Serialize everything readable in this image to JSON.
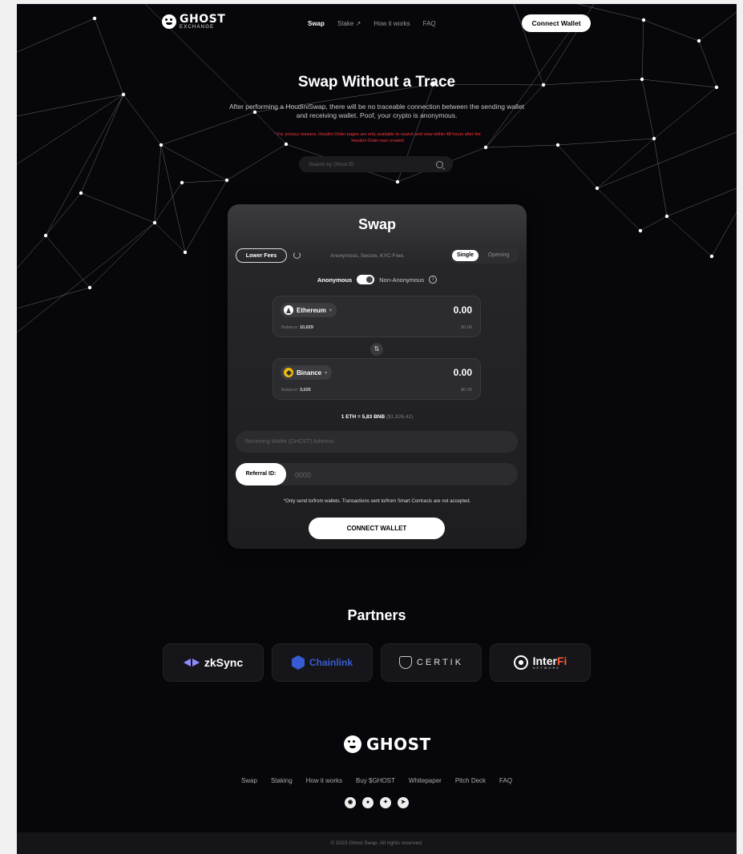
{
  "header": {
    "logo_title": "GHOST",
    "logo_sub": "EXCHANGE",
    "nav": [
      "Swap",
      "Stake ↗",
      "How it works",
      "FAQ"
    ],
    "connect_button": "Connect Wallet"
  },
  "hero": {
    "title": "Swap Without a Trace",
    "description": "After performing a HoudiniSwap, there will be no traceable connection between the sending wallet and receiving wallet. Poof, your crypto is anonymous.",
    "note": "* For privacy reasons, Houdini Order pages are only available to search and view within 48 hours after the Houdini Order was created",
    "search_placeholder": "Search by Ghost ID"
  },
  "swap": {
    "title": "Swap",
    "lower_fees": "Lower Fees",
    "features": "Anonymous, Secure, KYC-Free.",
    "mode_single": "Single",
    "mode_opening": "Opening",
    "anon_label": "Anonymous",
    "non_anon_label": "Non-Anonymous",
    "from": {
      "token": "Ethereum",
      "amount": "0.00",
      "balance_label": "Balance:",
      "balance": "10,029",
      "usd": "$0.00"
    },
    "to": {
      "token": "Binance",
      "amount": "0.00",
      "balance_label": "Balance:",
      "balance": "3,025",
      "usd": "$0.00"
    },
    "rate": "1 ETH = 5,83 BNB",
    "rate_usd": "($1,826,42)",
    "wallet_placeholder": "Receiving Wallet (GHOST) Address",
    "referral_label": "Referral ID:",
    "referral_placeholder": "0000",
    "warning": "*Only send to/from wallets. Transactions sent to/from Smart Contracts are not accepted.",
    "connect_button": "CONNECT WALLET"
  },
  "partners": {
    "title": "Partners",
    "items": {
      "zksync": "zkSync",
      "chainlink": "Chainlink",
      "certik": "CERTIK",
      "interfi_a": "Inter",
      "interfi_b": "Fi",
      "interfi_sub": "NETWORK"
    }
  },
  "footer": {
    "logo_title": "GHOST",
    "links": [
      "Swap",
      "Staking",
      "How it works",
      "Buy $GHOST",
      "Whitepaper",
      "Pitch Deck",
      "FAQ"
    ],
    "social": [
      "discord-icon",
      "medium-icon",
      "twitter-icon",
      "telegram-icon"
    ],
    "copyright": "© 2023 Ghost Swap. All rights reserved."
  },
  "colors": {
    "accent_red": "#ff3434",
    "interfi_orange": "#ff5a36",
    "chainlink_blue": "#375bd2",
    "zksync_purple": "#8c8dfc"
  }
}
